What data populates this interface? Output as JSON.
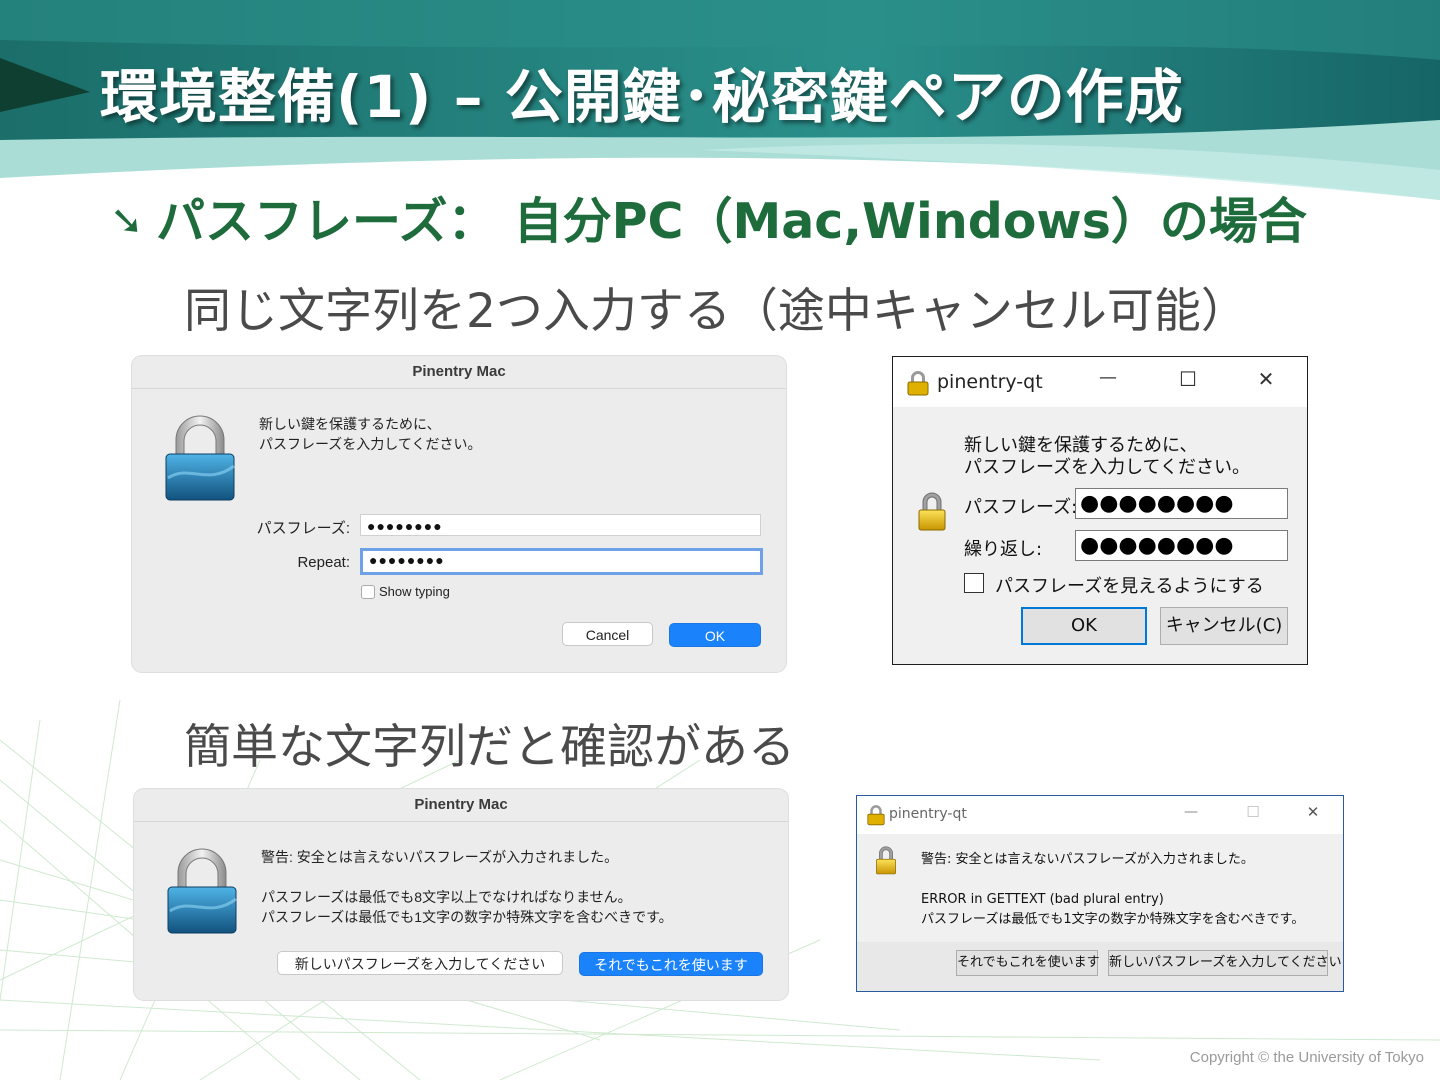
{
  "slide": {
    "title": "環境整備(1) – 公開鍵･秘密鍵ペアの作成",
    "subheading_arrow": "➘",
    "subheading": "パスフレーズ： 自分PC（Mac,Windows）の場合",
    "caption1": "同じ文字列を2つ入力する（途中キャンセル可能）",
    "caption2": "簡単な文字列だと確認がある",
    "copyright": "Copyright © the University of Tokyo",
    "colors": {
      "banner_dark": "#1f6f73",
      "banner_light": "#8fd3cf",
      "subheading": "#1e6b3c"
    }
  },
  "mac_dialog_1": {
    "title": "Pinentry Mac",
    "message_lines": [
      "新しい鍵を保護するために、",
      "パスフレーズを入力してください。"
    ],
    "passphrase_label": "パスフレーズ:",
    "passphrase_value": "●●●●●●●●",
    "repeat_label": "Repeat:",
    "repeat_value": "●●●●●●●●",
    "show_typing_label": "Show typing",
    "cancel_label": "Cancel",
    "ok_label": "OK",
    "icon": "padlock-icon"
  },
  "win_dialog_1": {
    "title": "pinentry-qt",
    "minimize": "—",
    "maximize": "☐",
    "close": "✕",
    "message_lines": [
      "新しい鍵を保護するために、",
      "パスフレーズを入力してください。"
    ],
    "passphrase_label": "パスフレーズ:",
    "passphrase_value": "●●●●●●●●",
    "repeat_label": "繰り返し:",
    "repeat_value": "●●●●●●●●",
    "show_label": "パスフレーズを見えるようにする",
    "ok_label": "OK",
    "cancel_label": "キャンセル(C)",
    "icon": "padlock-icon"
  },
  "mac_dialog_2": {
    "title": "Pinentry Mac",
    "warning": "警告: 安全とは言えないパスフレーズが入力されました。",
    "detail_lines": [
      "パスフレーズは最低でも8文字以上でなければなりません。",
      "パスフレーズは最低でも1文字の数字か特殊文字を含むべきです。"
    ],
    "new_passphrase_label": "新しいパスフレーズを入力してください",
    "use_anyway_label": "それでもこれを使います",
    "icon": "padlock-icon"
  },
  "win_dialog_2": {
    "title": "pinentry-qt",
    "minimize": "—",
    "maximize": "☐",
    "close": "✕",
    "warning": "警告: 安全とは言えないパスフレーズが入力されました。",
    "detail_lines": [
      "ERROR in GETTEXT (bad plural entry)",
      "パスフレーズは最低でも1文字の数字か特殊文字を含むべきです。"
    ],
    "use_anyway_label": "それでもこれを使います",
    "new_passphrase_label": "新しいパスフレーズを入力してください",
    "icon": "padlock-icon"
  }
}
